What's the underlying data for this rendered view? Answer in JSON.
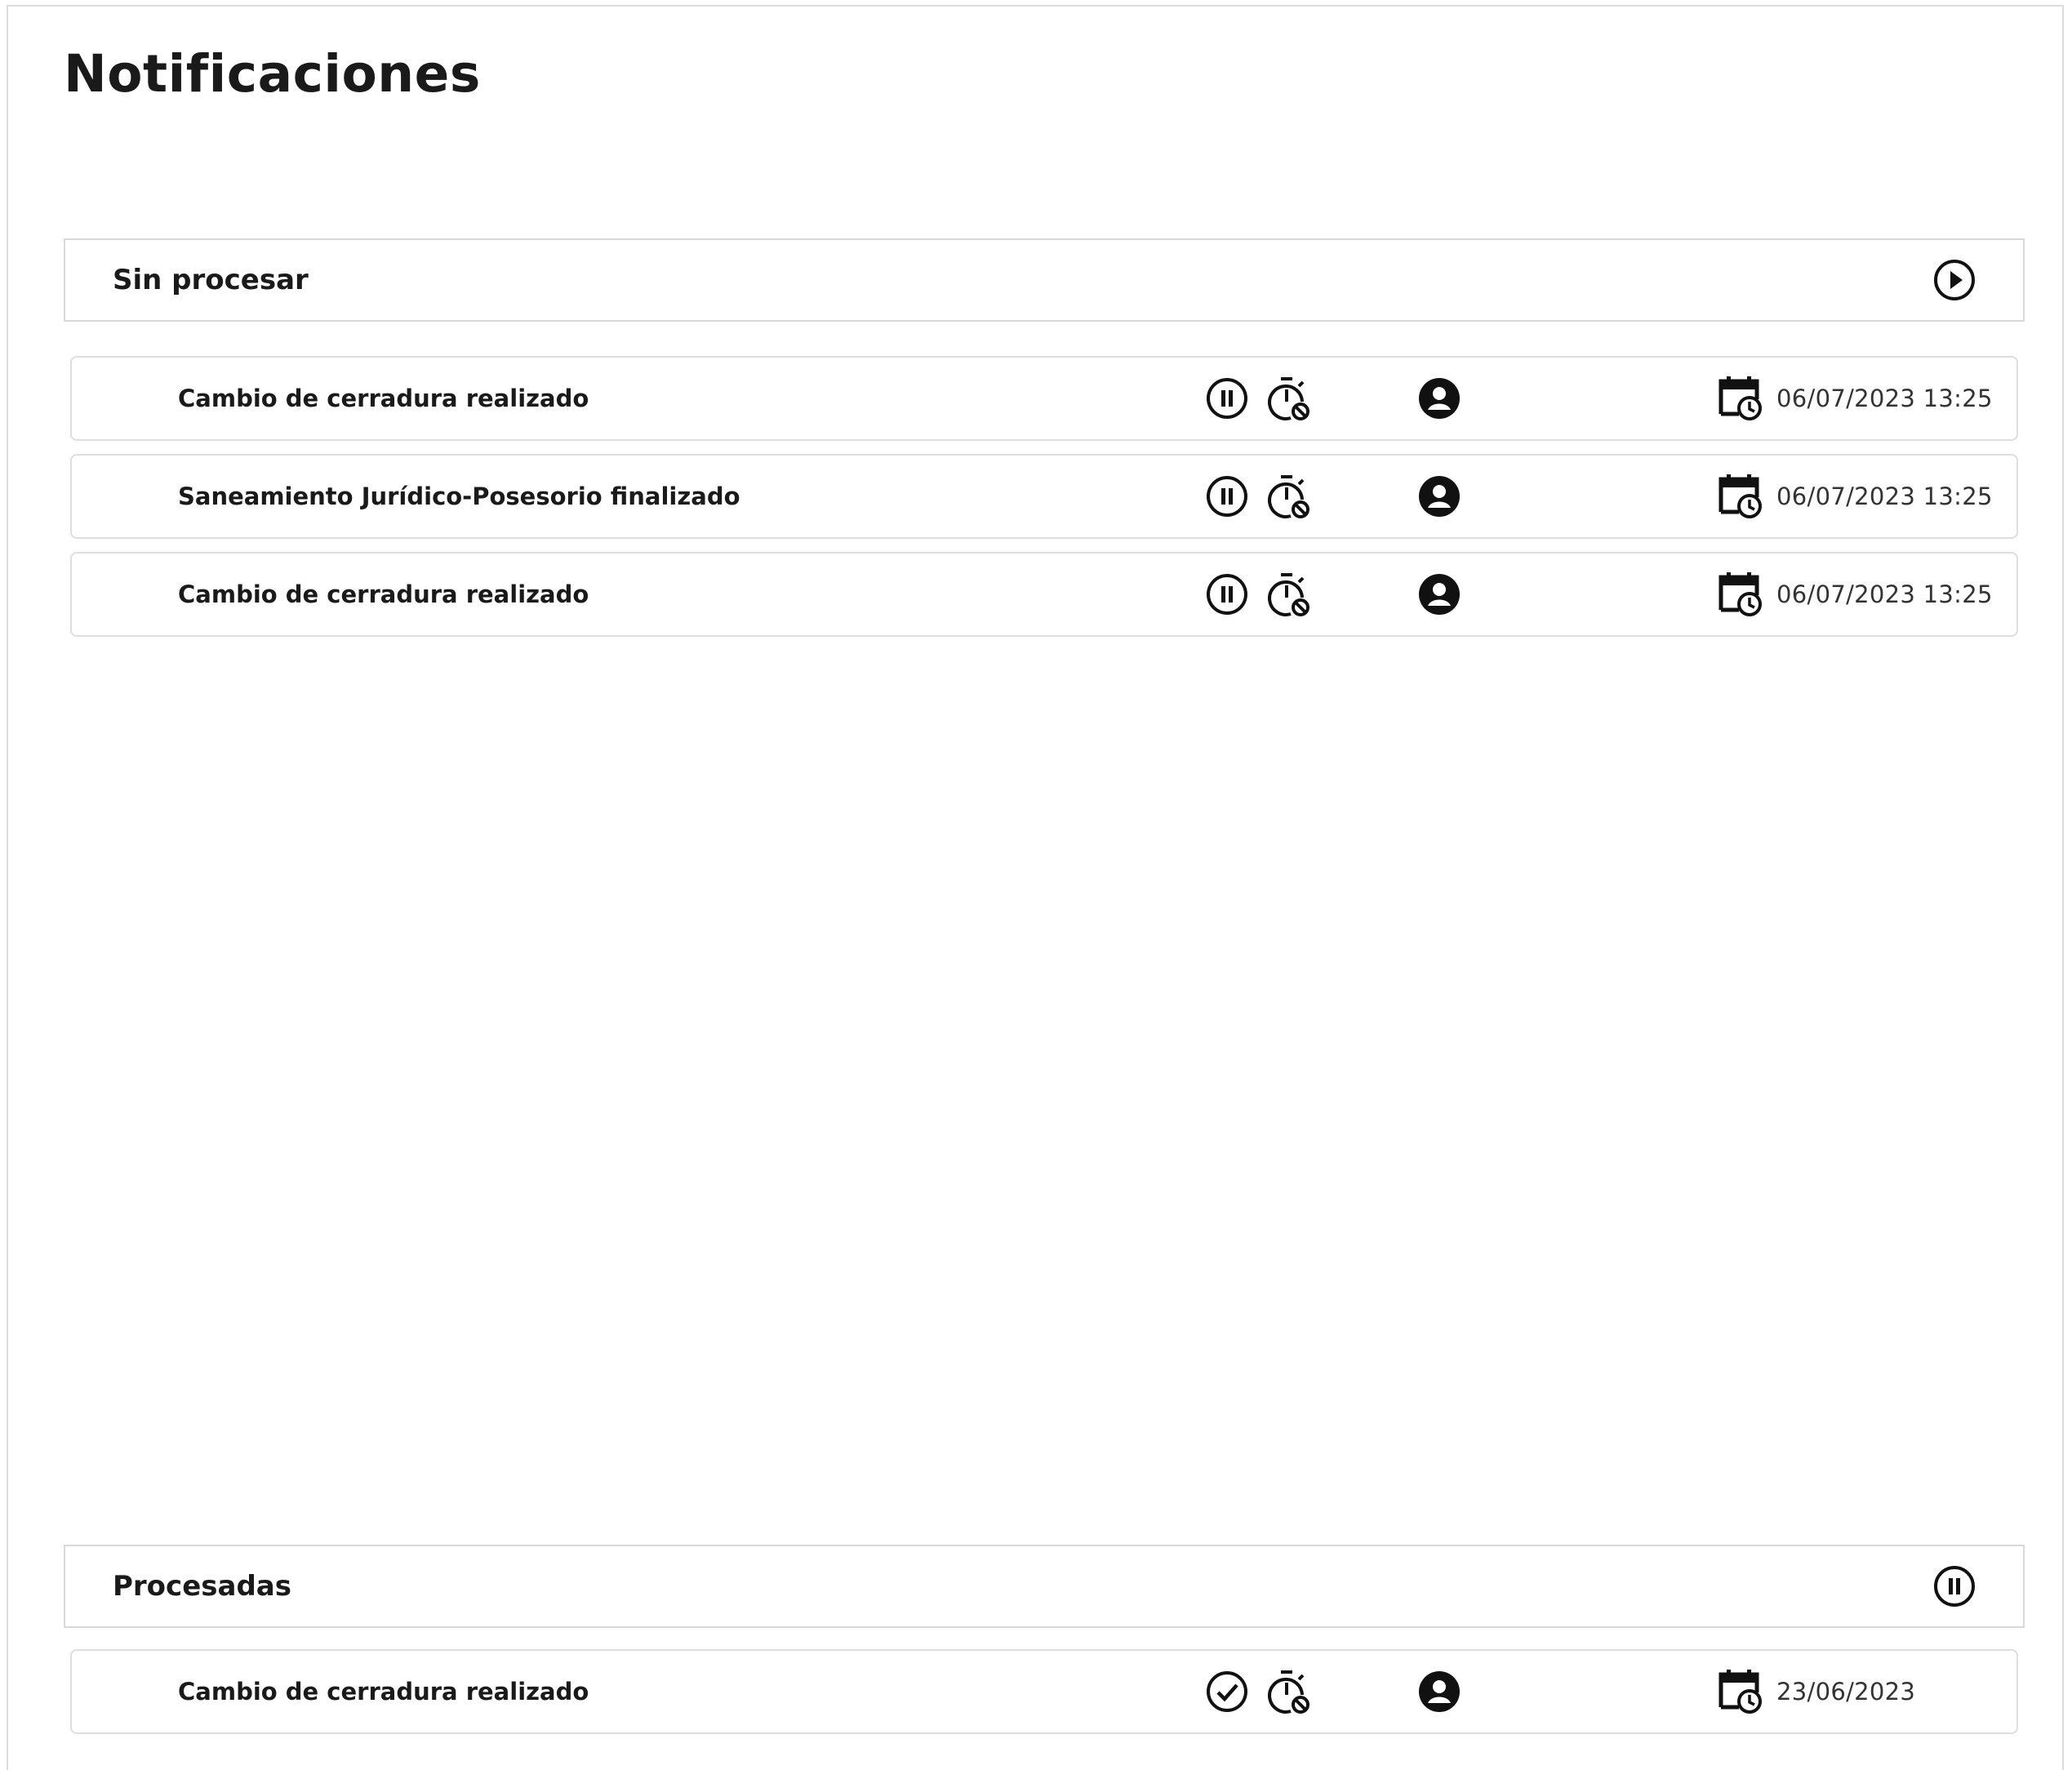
{
  "page": {
    "title": "Notificaciones"
  },
  "sections": [
    {
      "label": "Sin procesar",
      "toggle_icon": "play-circle-icon",
      "items": [
        {
          "title": "Cambio de cerradura realizado",
          "status_icon": "pause-circle-icon",
          "date": "06/07/2023 13:25"
        },
        {
          "title": "Saneamiento Jurídico-Posesorio finalizado",
          "status_icon": "pause-circle-icon",
          "date": "06/07/2023 13:25"
        },
        {
          "title": "Cambio de cerradura realizado",
          "status_icon": "pause-circle-icon",
          "date": "06/07/2023 13:25"
        }
      ]
    },
    {
      "label": "Procesadas",
      "toggle_icon": "pause-circle-icon",
      "items": [
        {
          "title": "Cambio de cerradura realizado",
          "status_icon": "check-circle-icon",
          "date": "23/06/2023"
        }
      ]
    }
  ],
  "colors": {
    "text": "#1a1a1a",
    "border": "#dedede",
    "background": "#ffffff"
  }
}
